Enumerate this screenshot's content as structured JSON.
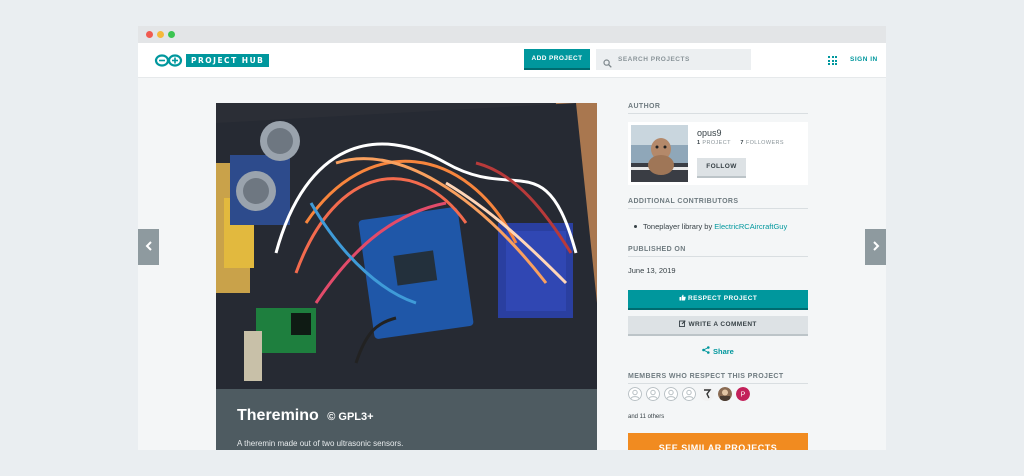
{
  "header": {
    "logo_text": "PROJECT HUB",
    "add_project_label": "ADD PROJECT",
    "search_placeholder": "SEARCH PROJECTS",
    "signin_label": "SIGN IN"
  },
  "project": {
    "title": "Theremino",
    "license": "© GPL3+",
    "description": "A theremin made out of two ultrasonic sensors."
  },
  "sidebar": {
    "author_heading": "AUTHOR",
    "author": {
      "name": "opus9",
      "projects_count": "1",
      "projects_label": "PROJECT",
      "followers_count": "7",
      "followers_label": "FOLLOWERS",
      "follow_label": "FOLLOW"
    },
    "contributors_heading": "ADDITIONAL CONTRIBUTORS",
    "contributor": {
      "text": "Toneplayer library by",
      "link": "ElectricRCAircraftGuy"
    },
    "published_heading": "PUBLISHED ON",
    "published_date": "June 13, 2019",
    "respect_label": "RESPECT PROJECT",
    "comment_label": "WRITE A COMMENT",
    "share_label": "Share",
    "members_heading": "MEMBERS WHO RESPECT THIS PROJECT",
    "members_more": "and 11 others",
    "similar_label": "SEE SIMILAR PROJECTS",
    "member_initial": "P"
  },
  "colors": {
    "accent": "#00979d",
    "orange": "#f18b20",
    "caption_bg": "#4e5b61"
  }
}
